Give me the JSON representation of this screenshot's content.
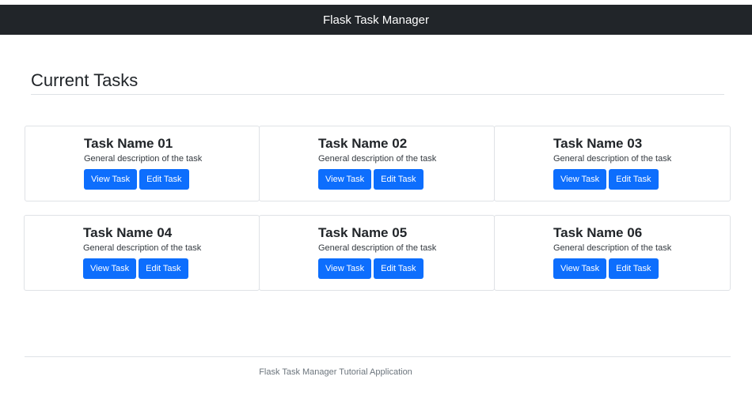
{
  "navbar": {
    "brand": "Flask Task Manager"
  },
  "main": {
    "heading": "Current Tasks",
    "tasks": [
      {
        "name": "Task Name 01",
        "description": "General description of the task",
        "view_label": "View Task",
        "edit_label": "Edit Task"
      },
      {
        "name": "Task Name 02",
        "description": "General description of the task",
        "view_label": "View Task",
        "edit_label": "Edit Task"
      },
      {
        "name": "Task Name 03",
        "description": "General description of the task",
        "view_label": "View Task",
        "edit_label": "Edit Task"
      },
      {
        "name": "Task Name 04",
        "description": "General description of the task",
        "view_label": "View Task",
        "edit_label": "Edit Task"
      },
      {
        "name": "Task Name 05",
        "description": "General description of the task",
        "view_label": "View Task",
        "edit_label": "Edit Task"
      },
      {
        "name": "Task Name 06",
        "description": "General description of the task",
        "view_label": "View Task",
        "edit_label": "Edit Task"
      }
    ]
  },
  "footer": {
    "text": "Flask Task Manager Tutorial Application"
  },
  "colors": {
    "navbar_bg": "#212529",
    "primary": "#0d6efd",
    "border": "#dee2e6"
  }
}
